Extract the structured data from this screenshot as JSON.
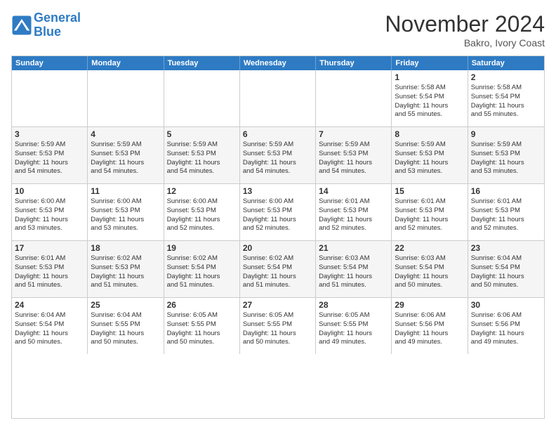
{
  "header": {
    "logo_line1": "General",
    "logo_line2": "Blue",
    "month": "November 2024",
    "location": "Bakro, Ivory Coast"
  },
  "days_of_week": [
    "Sunday",
    "Monday",
    "Tuesday",
    "Wednesday",
    "Thursday",
    "Friday",
    "Saturday"
  ],
  "weeks": [
    [
      {
        "day": "",
        "info": ""
      },
      {
        "day": "",
        "info": ""
      },
      {
        "day": "",
        "info": ""
      },
      {
        "day": "",
        "info": ""
      },
      {
        "day": "",
        "info": ""
      },
      {
        "day": "1",
        "info": "Sunrise: 5:58 AM\nSunset: 5:54 PM\nDaylight: 11 hours\nand 55 minutes."
      },
      {
        "day": "2",
        "info": "Sunrise: 5:58 AM\nSunset: 5:54 PM\nDaylight: 11 hours\nand 55 minutes."
      }
    ],
    [
      {
        "day": "3",
        "info": "Sunrise: 5:59 AM\nSunset: 5:53 PM\nDaylight: 11 hours\nand 54 minutes."
      },
      {
        "day": "4",
        "info": "Sunrise: 5:59 AM\nSunset: 5:53 PM\nDaylight: 11 hours\nand 54 minutes."
      },
      {
        "day": "5",
        "info": "Sunrise: 5:59 AM\nSunset: 5:53 PM\nDaylight: 11 hours\nand 54 minutes."
      },
      {
        "day": "6",
        "info": "Sunrise: 5:59 AM\nSunset: 5:53 PM\nDaylight: 11 hours\nand 54 minutes."
      },
      {
        "day": "7",
        "info": "Sunrise: 5:59 AM\nSunset: 5:53 PM\nDaylight: 11 hours\nand 54 minutes."
      },
      {
        "day": "8",
        "info": "Sunrise: 5:59 AM\nSunset: 5:53 PM\nDaylight: 11 hours\nand 53 minutes."
      },
      {
        "day": "9",
        "info": "Sunrise: 5:59 AM\nSunset: 5:53 PM\nDaylight: 11 hours\nand 53 minutes."
      }
    ],
    [
      {
        "day": "10",
        "info": "Sunrise: 6:00 AM\nSunset: 5:53 PM\nDaylight: 11 hours\nand 53 minutes."
      },
      {
        "day": "11",
        "info": "Sunrise: 6:00 AM\nSunset: 5:53 PM\nDaylight: 11 hours\nand 53 minutes."
      },
      {
        "day": "12",
        "info": "Sunrise: 6:00 AM\nSunset: 5:53 PM\nDaylight: 11 hours\nand 52 minutes."
      },
      {
        "day": "13",
        "info": "Sunrise: 6:00 AM\nSunset: 5:53 PM\nDaylight: 11 hours\nand 52 minutes."
      },
      {
        "day": "14",
        "info": "Sunrise: 6:01 AM\nSunset: 5:53 PM\nDaylight: 11 hours\nand 52 minutes."
      },
      {
        "day": "15",
        "info": "Sunrise: 6:01 AM\nSunset: 5:53 PM\nDaylight: 11 hours\nand 52 minutes."
      },
      {
        "day": "16",
        "info": "Sunrise: 6:01 AM\nSunset: 5:53 PM\nDaylight: 11 hours\nand 52 minutes."
      }
    ],
    [
      {
        "day": "17",
        "info": "Sunrise: 6:01 AM\nSunset: 5:53 PM\nDaylight: 11 hours\nand 51 minutes."
      },
      {
        "day": "18",
        "info": "Sunrise: 6:02 AM\nSunset: 5:53 PM\nDaylight: 11 hours\nand 51 minutes."
      },
      {
        "day": "19",
        "info": "Sunrise: 6:02 AM\nSunset: 5:54 PM\nDaylight: 11 hours\nand 51 minutes."
      },
      {
        "day": "20",
        "info": "Sunrise: 6:02 AM\nSunset: 5:54 PM\nDaylight: 11 hours\nand 51 minutes."
      },
      {
        "day": "21",
        "info": "Sunrise: 6:03 AM\nSunset: 5:54 PM\nDaylight: 11 hours\nand 51 minutes."
      },
      {
        "day": "22",
        "info": "Sunrise: 6:03 AM\nSunset: 5:54 PM\nDaylight: 11 hours\nand 50 minutes."
      },
      {
        "day": "23",
        "info": "Sunrise: 6:04 AM\nSunset: 5:54 PM\nDaylight: 11 hours\nand 50 minutes."
      }
    ],
    [
      {
        "day": "24",
        "info": "Sunrise: 6:04 AM\nSunset: 5:54 PM\nDaylight: 11 hours\nand 50 minutes."
      },
      {
        "day": "25",
        "info": "Sunrise: 6:04 AM\nSunset: 5:55 PM\nDaylight: 11 hours\nand 50 minutes."
      },
      {
        "day": "26",
        "info": "Sunrise: 6:05 AM\nSunset: 5:55 PM\nDaylight: 11 hours\nand 50 minutes."
      },
      {
        "day": "27",
        "info": "Sunrise: 6:05 AM\nSunset: 5:55 PM\nDaylight: 11 hours\nand 50 minutes."
      },
      {
        "day": "28",
        "info": "Sunrise: 6:05 AM\nSunset: 5:55 PM\nDaylight: 11 hours\nand 49 minutes."
      },
      {
        "day": "29",
        "info": "Sunrise: 6:06 AM\nSunset: 5:56 PM\nDaylight: 11 hours\nand 49 minutes."
      },
      {
        "day": "30",
        "info": "Sunrise: 6:06 AM\nSunset: 5:56 PM\nDaylight: 11 hours\nand 49 minutes."
      }
    ]
  ]
}
